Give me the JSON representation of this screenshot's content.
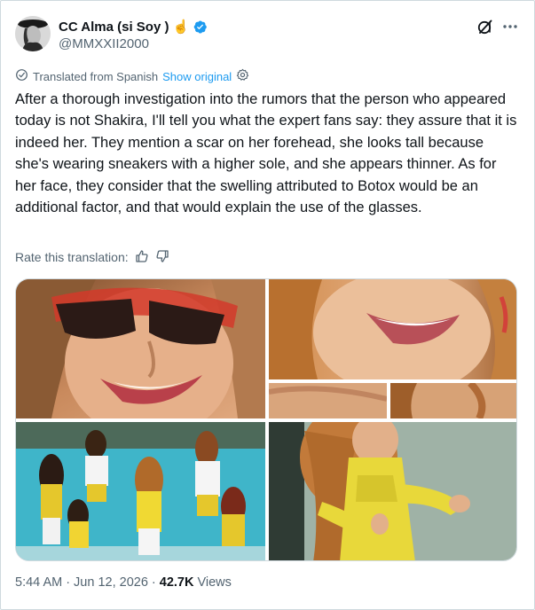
{
  "author": {
    "display_name": "CC Alma (si Soy ) ⏩",
    "display_name_text": "CC Alma (si Soy ) ☝️",
    "handle": "@MMXXII2000",
    "verified": true
  },
  "translation": {
    "translated_label": "Translated from Spanish",
    "show_original": "Show original",
    "rate_label": "Rate this translation:"
  },
  "tweet": {
    "text": "After a thorough investigation into the rumors that the person who appeared today is not Shakira, I'll tell you what the expert fans say: they assure that it is indeed her. They mention a scar on her forehead, she looks tall because she's wearing sneakers with a higher sole, and she appears thinner. As for her face, they consider that the swelling attributed to Botox would be an additional factor, and that would explain the use of the glasses."
  },
  "meta": {
    "time": "5:44 AM",
    "separator": "·",
    "date": "Jun 12, 2026",
    "views_count": "42.7K",
    "views_label": "Views"
  },
  "icons": {
    "verified": "verified-badge-icon",
    "grok": "grok-icon",
    "more": "more-icon",
    "translate": "translate-icon",
    "settings": "settings-icon",
    "thumbs_up": "thumbs-up-icon",
    "thumbs_down": "thumbs-down-icon"
  },
  "colors": {
    "accent": "#1d9bf0",
    "text": "#0f1419",
    "muted": "#536471",
    "border": "#cfd9de"
  }
}
